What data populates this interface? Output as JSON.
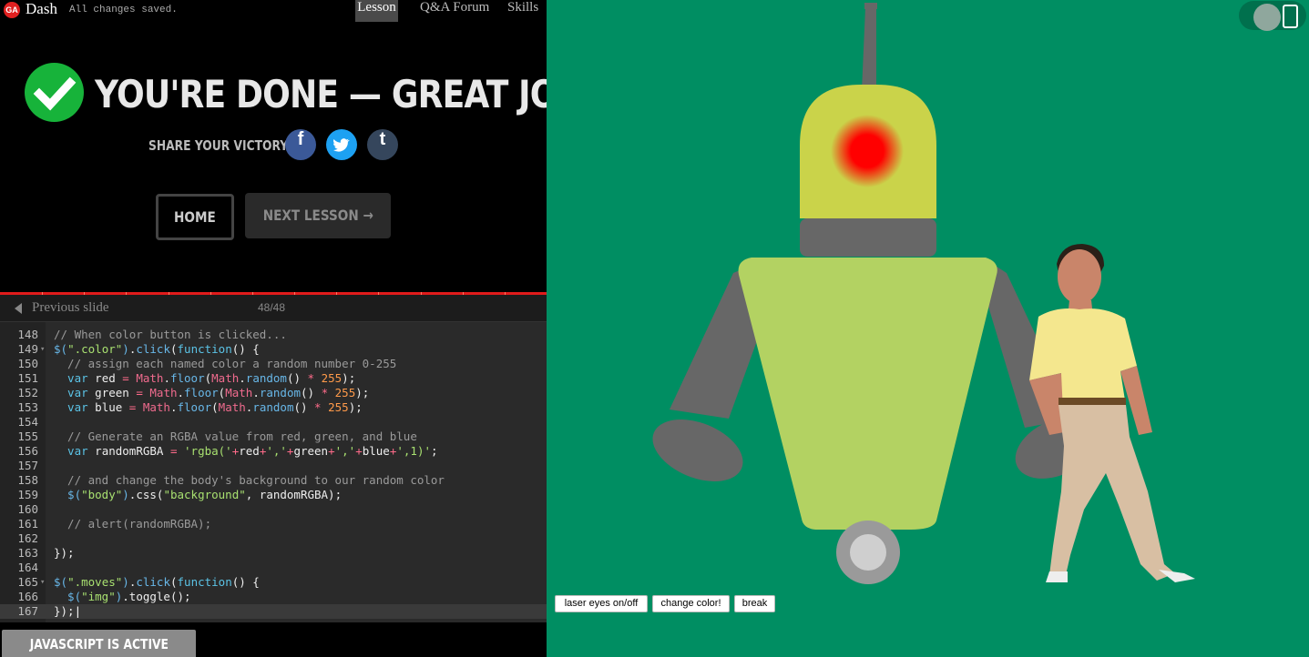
{
  "topbar": {
    "logo": "GA",
    "app_name": "Dash",
    "save_status": "All changes saved.",
    "tabs": [
      {
        "label": "Lesson",
        "active": true
      },
      {
        "label": "Q&A Forum",
        "active": false
      },
      {
        "label": "Skills",
        "active": false
      }
    ]
  },
  "completion": {
    "title": "YOU'RE DONE — GREAT JOB!",
    "share_label": "SHARE YOUR VICTORY:",
    "share_buttons": [
      {
        "glyph": "f",
        "icon": "facebook-icon"
      },
      {
        "glyph": "t",
        "icon": "twitter-icon"
      },
      {
        "glyph": "t",
        "icon": "tumblr-icon"
      }
    ],
    "home_label": "HOME",
    "next_label": "NEXT LESSON →"
  },
  "slides": {
    "prev_label": "Previous slide",
    "count": "48/48",
    "progress_fraction": 1.0
  },
  "editor": {
    "lines": [
      {
        "n": "148",
        "fold": false,
        "tokens": [
          [
            "c-cm",
            "// When color button is clicked..."
          ]
        ]
      },
      {
        "n": "149",
        "fold": true,
        "tokens": [
          [
            "c-fn",
            "$("
          ],
          [
            "c-str",
            "\".color\""
          ],
          [
            "c-fn",
            ")"
          ],
          [
            "",
            "."
          ],
          [
            "c-fn",
            "click"
          ],
          [
            "",
            "("
          ],
          [
            "c-kw",
            "function"
          ],
          [
            "",
            "() {"
          ]
        ]
      },
      {
        "n": "150",
        "fold": false,
        "tokens": [
          [
            "c-cm",
            "  // assign each named color a random number 0-255"
          ]
        ]
      },
      {
        "n": "151",
        "fold": false,
        "tokens": [
          [
            "c-kw",
            "  var"
          ],
          [
            "",
            " red "
          ],
          [
            "c-op",
            "="
          ],
          [
            "",
            " "
          ],
          [
            "c-obj",
            "Math"
          ],
          [
            "",
            "."
          ],
          [
            "c-fn",
            "floor"
          ],
          [
            "",
            "("
          ],
          [
            "c-obj",
            "Math"
          ],
          [
            "",
            "."
          ],
          [
            "c-fn",
            "random"
          ],
          [
            "",
            "() "
          ],
          [
            "c-op",
            "*"
          ],
          [
            "",
            " "
          ],
          [
            "c-num",
            "255"
          ],
          [
            "",
            ");"
          ]
        ]
      },
      {
        "n": "152",
        "fold": false,
        "tokens": [
          [
            "c-kw",
            "  var"
          ],
          [
            "",
            " green "
          ],
          [
            "c-op",
            "="
          ],
          [
            "",
            " "
          ],
          [
            "c-obj",
            "Math"
          ],
          [
            "",
            "."
          ],
          [
            "c-fn",
            "floor"
          ],
          [
            "",
            "("
          ],
          [
            "c-obj",
            "Math"
          ],
          [
            "",
            "."
          ],
          [
            "c-fn",
            "random"
          ],
          [
            "",
            "() "
          ],
          [
            "c-op",
            "*"
          ],
          [
            "",
            " "
          ],
          [
            "c-num",
            "255"
          ],
          [
            "",
            ");"
          ]
        ]
      },
      {
        "n": "153",
        "fold": false,
        "tokens": [
          [
            "c-kw",
            "  var"
          ],
          [
            "",
            " blue "
          ],
          [
            "c-op",
            "="
          ],
          [
            "",
            " "
          ],
          [
            "c-obj",
            "Math"
          ],
          [
            "",
            "."
          ],
          [
            "c-fn",
            "floor"
          ],
          [
            "",
            "("
          ],
          [
            "c-obj",
            "Math"
          ],
          [
            "",
            "."
          ],
          [
            "c-fn",
            "random"
          ],
          [
            "",
            "() "
          ],
          [
            "c-op",
            "*"
          ],
          [
            "",
            " "
          ],
          [
            "c-num",
            "255"
          ],
          [
            "",
            ");"
          ]
        ]
      },
      {
        "n": "154",
        "fold": false,
        "tokens": []
      },
      {
        "n": "155",
        "fold": false,
        "tokens": [
          [
            "c-cm",
            "  // Generate an RGBA value from red, green, and blue"
          ]
        ]
      },
      {
        "n": "156",
        "fold": false,
        "tokens": [
          [
            "c-kw",
            "  var"
          ],
          [
            "",
            " randomRGBA "
          ],
          [
            "c-op",
            "="
          ],
          [
            "",
            " "
          ],
          [
            "c-str",
            "'rgba('"
          ],
          [
            "c-op",
            "+"
          ],
          [
            "",
            "red"
          ],
          [
            "c-op",
            "+"
          ],
          [
            "c-str",
            "','"
          ],
          [
            "c-op",
            "+"
          ],
          [
            "",
            "green"
          ],
          [
            "c-op",
            "+"
          ],
          [
            "c-str",
            "','"
          ],
          [
            "c-op",
            "+"
          ],
          [
            "",
            "blue"
          ],
          [
            "c-op",
            "+"
          ],
          [
            "c-str",
            "',1)'"
          ],
          [
            "",
            ";"
          ]
        ]
      },
      {
        "n": "157",
        "fold": false,
        "tokens": []
      },
      {
        "n": "158",
        "fold": false,
        "tokens": [
          [
            "c-cm",
            "  // and change the body's background to our random color"
          ]
        ]
      },
      {
        "n": "159",
        "fold": false,
        "tokens": [
          [
            "c-fn",
            "  $("
          ],
          [
            "c-str",
            "\"body\""
          ],
          [
            "c-fn",
            ")"
          ],
          [
            "",
            "."
          ],
          [
            "",
            "css("
          ],
          [
            "c-str",
            "\"background\""
          ],
          [
            "",
            ", randomRGBA);"
          ]
        ]
      },
      {
        "n": "160",
        "fold": false,
        "tokens": []
      },
      {
        "n": "161",
        "fold": false,
        "tokens": [
          [
            "c-cm",
            "  // alert(randomRGBA);"
          ]
        ]
      },
      {
        "n": "162",
        "fold": false,
        "tokens": []
      },
      {
        "n": "163",
        "fold": false,
        "tokens": [
          [
            "",
            "});"
          ]
        ]
      },
      {
        "n": "164",
        "fold": false,
        "tokens": []
      },
      {
        "n": "165",
        "fold": true,
        "tokens": [
          [
            "c-fn",
            "$("
          ],
          [
            "c-str",
            "\".moves\""
          ],
          [
            "c-fn",
            ")"
          ],
          [
            "",
            "."
          ],
          [
            "c-fn",
            "click"
          ],
          [
            "",
            "("
          ],
          [
            "c-kw",
            "function"
          ],
          [
            "",
            "() {"
          ]
        ]
      },
      {
        "n": "166",
        "fold": false,
        "tokens": [
          [
            "c-fn",
            "  $("
          ],
          [
            "c-str",
            "\"img\""
          ],
          [
            "c-fn",
            ")"
          ],
          [
            "",
            ".toggle();"
          ]
        ]
      },
      {
        "n": "167",
        "fold": false,
        "current": true,
        "tokens": [
          [
            "",
            "});"
          ]
        ]
      }
    ]
  },
  "status": {
    "js_label": "JAVASCRIPT IS ACTIVE"
  },
  "preview": {
    "background_color": "#008e62",
    "robot_head_color": "#cad34a",
    "robot_body_color": "#b3d262",
    "robot_limb_color": "#676767",
    "laser_eye_color": "#ff0000",
    "buttons": {
      "laser": "laser eyes on/off",
      "color": "change color!",
      "break": "break"
    }
  }
}
